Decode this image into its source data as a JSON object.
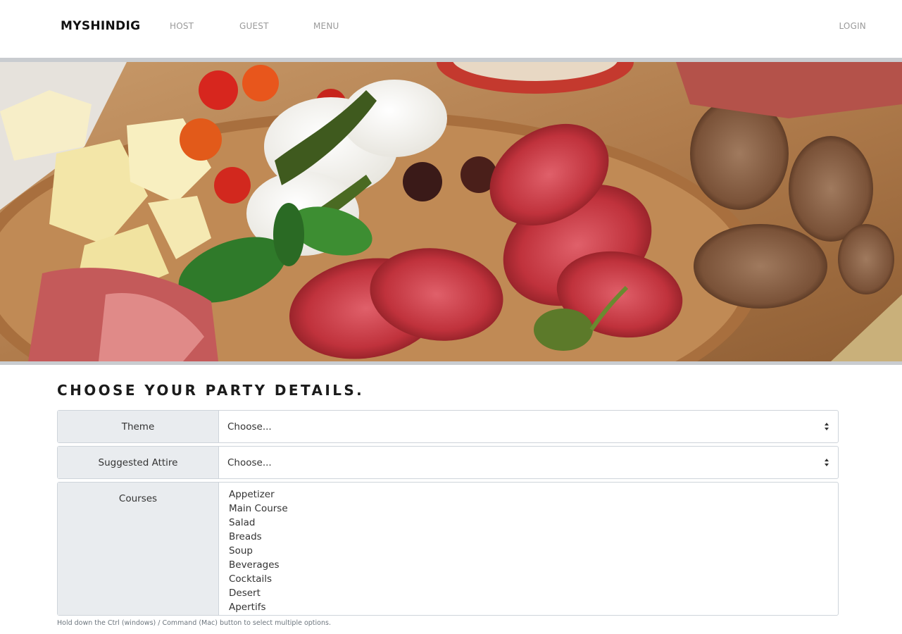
{
  "navbar": {
    "brand": "MYSHINDIG",
    "links": [
      "HOST",
      "GUEST",
      "MENU"
    ],
    "login": "LOGIN"
  },
  "hero": {
    "image_description": "food-platter-banner"
  },
  "form": {
    "title": "CHOOSE YOUR PARTY DETAILS.",
    "theme": {
      "label": "Theme",
      "value": "Choose..."
    },
    "attire": {
      "label": "Suggested Attire",
      "value": "Choose..."
    },
    "courses": {
      "label": "Courses",
      "options": [
        "Appetizer",
        "Main Course",
        "Salad",
        "Breads",
        "Soup",
        "Beverages",
        "Cocktails",
        "Desert",
        "Apertifs"
      ]
    },
    "help": "Hold down the Ctrl (windows) / Command (Mac) button to select multiple options."
  },
  "colors": {
    "label_bg": "#e9ecef",
    "border": "#ced4da",
    "nav_link": "#9a9a9a"
  }
}
